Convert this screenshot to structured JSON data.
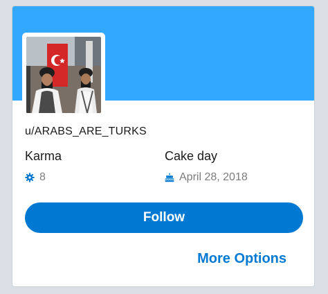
{
  "profile": {
    "username": "u/ARABS_ARE_TURKS",
    "banner_color": "#33a8ff",
    "avatar": "photo of men standing in front of a red flag"
  },
  "stats": {
    "karma_label": "Karma",
    "karma_icon": "karma-gear-icon",
    "karma_value": "8",
    "cake_label": "Cake day",
    "cake_icon": "cake-icon",
    "cake_value": "April 28, 2018"
  },
  "actions": {
    "follow_label": "Follow",
    "follow_color": "#0079d3",
    "more_options_label": "More Options"
  }
}
